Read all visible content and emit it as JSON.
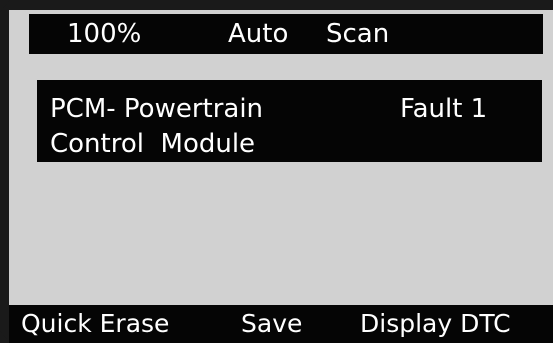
{
  "title_bar": {
    "zoom": "100%",
    "mode": "Auto",
    "function": "Scan"
  },
  "module": {
    "line1": "PCM- Powertrain",
    "line2": "Control  Module",
    "fault_label": "Fault 1"
  },
  "softkeys": [
    {
      "label": "Quick Erase"
    },
    {
      "label": "Save"
    },
    {
      "label": "Display DTC"
    }
  ],
  "colors": {
    "screen_background": "#d1d1d1",
    "bar_background": "#050505",
    "text_on_bar": "#ffffff",
    "frame": "#1a1a1a"
  }
}
